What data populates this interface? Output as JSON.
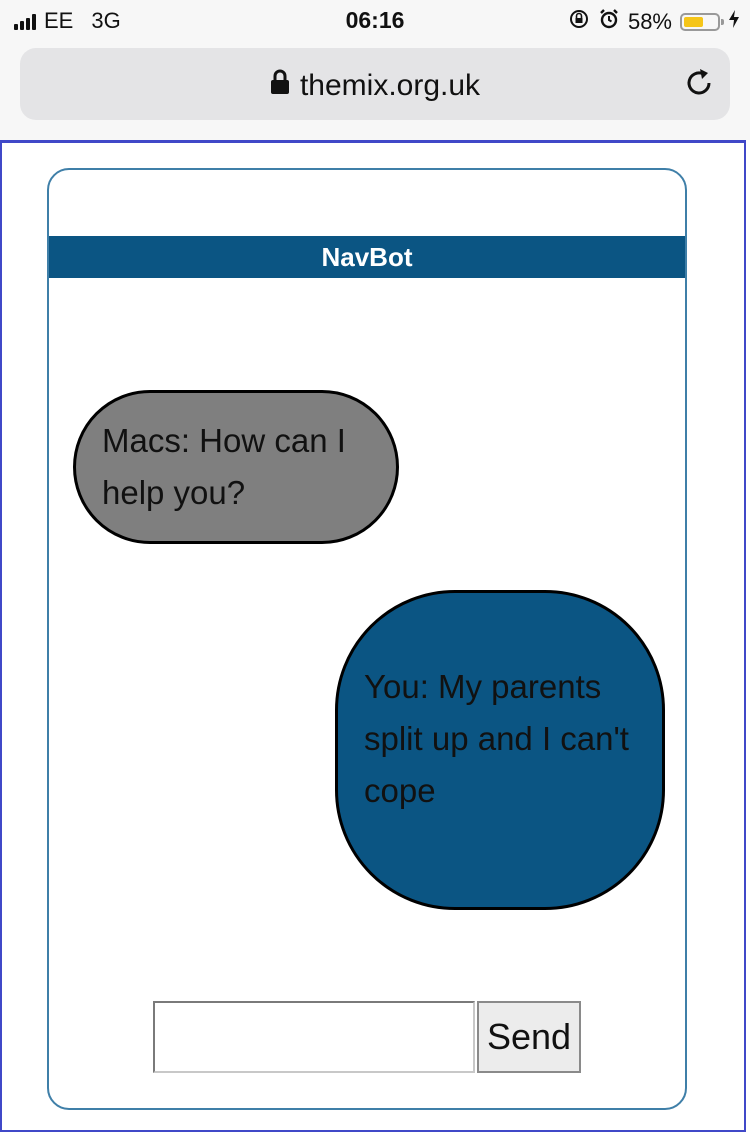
{
  "status_bar": {
    "carrier": "EE",
    "network": "3G",
    "time": "06:16",
    "battery_percent": "58%",
    "battery_level": 0.58,
    "icons": [
      "signal-icon",
      "orientation-lock-icon",
      "alarm-icon",
      "battery-icon",
      "charging-icon"
    ]
  },
  "browser": {
    "url": "themix.org.uk",
    "icons": [
      "lock-icon",
      "reload-icon"
    ]
  },
  "chat": {
    "title": "NavBot",
    "messages": [
      {
        "sender": "bot",
        "text": "Macs: How can I help you?"
      },
      {
        "sender": "user",
        "text": "You: My parents split up and I can't cope"
      }
    ],
    "input_value": "",
    "send_label": "Send"
  },
  "colors": {
    "header": "#0b5583",
    "bot_bubble": "#7f7f7f",
    "user_bubble": "#0b5583",
    "page_border": "#4048c8",
    "battery_fill": "#f5c518"
  }
}
